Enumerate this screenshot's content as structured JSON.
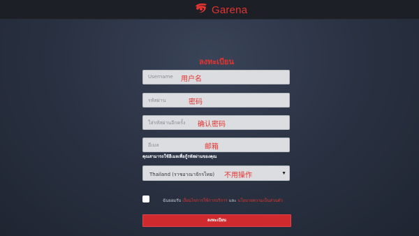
{
  "header": {
    "brand_name": "Garena",
    "logo_icon": "garena-logo-icon",
    "brand_color": "#e3342f"
  },
  "form": {
    "title": "ลงทะเบียน",
    "fields": [
      {
        "placeholder": "Username",
        "annotation": "用户名"
      },
      {
        "placeholder": "รหัสผ่าน",
        "annotation": "密码"
      },
      {
        "placeholder": "ใส่รหัสผ่านอีกครั้ง",
        "annotation": "确认密码"
      },
      {
        "placeholder": "อีเมล",
        "annotation": "邮箱"
      }
    ],
    "email_hint": "คุณสามารถใช้อีเมลเพื่อกู้รหัสผ่านของคุณ",
    "country_select": {
      "value": "Thailand (ราชอาณาจักรไทย)",
      "annotation": "不用操作",
      "caret_icon": "chevron-down-icon"
    },
    "agreement": {
      "prefix": "ฉันยอมรับ",
      "terms_link": "เงื่อนไขการใช้การบริการ",
      "conjunction": "และ",
      "privacy_link": "นโยบายความเป็นส่วนตัว"
    },
    "submit_label": "ลงทะเบียน"
  }
}
